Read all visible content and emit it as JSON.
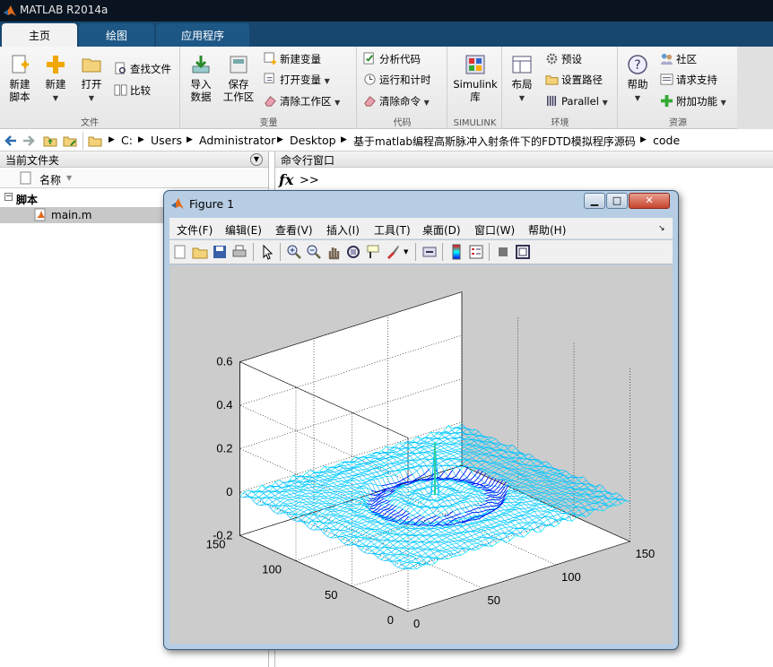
{
  "app": {
    "title": "MATLAB R2014a"
  },
  "tabs": [
    {
      "label": "主页",
      "active": true
    },
    {
      "label": "绘图",
      "active": false
    },
    {
      "label": "应用程序",
      "active": false
    }
  ],
  "ribbon": {
    "file": {
      "section": "文件",
      "new_script": "新建\n脚本",
      "new": "新建",
      "open": "打开",
      "find_files": "查找文件",
      "compare": "比较"
    },
    "variable": {
      "section": "变量",
      "import": "导入\n数据",
      "save_ws": "保存\n工作区",
      "new_var": "新建变量",
      "open_var": "打开变量",
      "clear_ws": "清除工作区"
    },
    "code": {
      "section": "代码",
      "analyze": "分析代码",
      "run_time": "运行和计时",
      "clear_cmd": "清除命令"
    },
    "simulink": {
      "section": "SIMULINK",
      "btn": "Simulink\n库"
    },
    "env": {
      "section": "环境",
      "layout": "布局",
      "prefs": "预设",
      "set_path": "设置路径",
      "parallel": "Parallel"
    },
    "resources": {
      "section": "资源",
      "help": "帮助",
      "community": "社区",
      "support": "请求支持",
      "addons": "附加功能"
    }
  },
  "address": {
    "crumbs": [
      "C:",
      "Users",
      "Administrator",
      "Desktop",
      "基于matlab编程高斯脉冲入射条件下的FDTD模拟程序源码",
      "code"
    ]
  },
  "left_pane": {
    "title": "当前文件夹",
    "column_name": "名称",
    "group": "脚本",
    "file": "main.m"
  },
  "command_window": {
    "title": "命令行窗口",
    "fx": "fx",
    "prompt": ">>"
  },
  "figure": {
    "title": "Figure 1",
    "menu": [
      "文件(F)",
      "编辑(E)",
      "查看(V)",
      "插入(I)",
      "工具(T)",
      "桌面(D)",
      "窗口(W)",
      "帮助(H)"
    ],
    "toolbar_icons": [
      "new-figure-icon",
      "open-icon",
      "save-icon",
      "print-icon",
      "pointer-icon",
      "zoom-in-icon",
      "zoom-out-icon",
      "pan-icon",
      "rotate-icon",
      "data-cursor-icon",
      "brush-icon",
      "link-icon",
      "colorbar-icon",
      "legend-icon",
      "hide-plot-tools-icon",
      "show-plot-tools-icon"
    ]
  },
  "chart_data": {
    "type": "surface",
    "title": "",
    "z_ticks": [
      "-0.2",
      "0",
      "0.2",
      "0.4",
      "0.6"
    ],
    "y_ticks": [
      "0",
      "50",
      "100",
      "150"
    ],
    "x_ticks": [
      "0",
      "50",
      "100",
      "150"
    ],
    "zlim": [
      -0.2,
      0.6
    ],
    "xlim": [
      0,
      150
    ],
    "ylim": [
      0,
      150
    ],
    "grid": true,
    "colormap": "jet",
    "peak_value": 0.24,
    "min_value": -0.05
  }
}
